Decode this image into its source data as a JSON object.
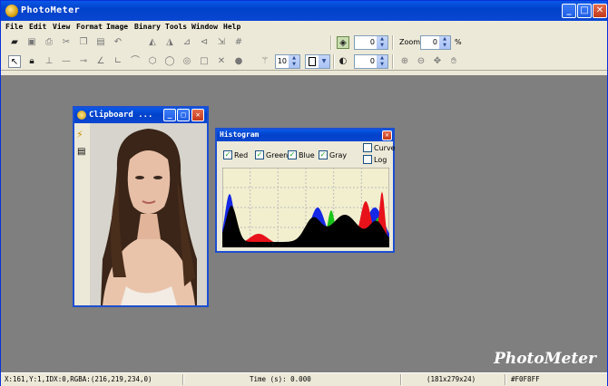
{
  "window": {
    "title": "PhotoMeter",
    "buttons": {
      "min": "_",
      "max": "□",
      "close": "✕"
    }
  },
  "menu": [
    "File",
    "Edit",
    "View",
    "Format",
    "Image",
    "Binary",
    "Tools",
    "Window",
    "Help"
  ],
  "toolbar1": {
    "icons": [
      "open-folder-icon",
      "save-icon",
      "print-icon",
      "cut-icon",
      "copy-icon",
      "paste-icon",
      "undo-icon",
      "mirror-icon",
      "flip-icon",
      "rotate-left-icon",
      "rotate-right-icon",
      "resize-icon",
      "grid-icon"
    ],
    "channel_value": "0",
    "zoom_label": "Zoom:",
    "zoom_value": "0",
    "zoom_unit": "%"
  },
  "toolbar2": {
    "icons": [
      "pointer-icon",
      "lock-icon",
      "tool-t-icon",
      "tool-line-icon",
      "tool-dash-icon",
      "tool-angle-icon",
      "tool-corner-icon",
      "tool-polyline-icon",
      "tool-polygon-icon",
      "tool-circle-icon",
      "tool-target-icon",
      "tool-rect-icon",
      "tool-x-icon",
      "tool-dot-icon",
      "tool-wand-icon"
    ],
    "size_value": "10",
    "contrast_value": "0",
    "view_icons": [
      "zoom-in-icon",
      "zoom-out-icon",
      "move-icon",
      "hand-icon"
    ]
  },
  "clipboard": {
    "title": "Clipboard ...",
    "side_icons": [
      "lightning-icon",
      "list-icon"
    ]
  },
  "histogram": {
    "title": "Histogram",
    "channels": [
      {
        "label": "Red",
        "checked": true
      },
      {
        "label": "Green",
        "checked": true
      },
      {
        "label": "Blue",
        "checked": true
      },
      {
        "label": "Gray",
        "checked": true
      }
    ],
    "options": [
      {
        "label": "Curve",
        "checked": false
      },
      {
        "label": "Log",
        "checked": false
      }
    ],
    "colors": {
      "red": "#e8121a",
      "green": "#18c418",
      "blue": "#1428e6",
      "gray": "#000000",
      "background": "#f2efcf"
    }
  },
  "brand": "PhotoMeter",
  "status": {
    "coords": "X:161,Y:1,IDX:0,RGBA:(216,219,234,0)",
    "time": "Time (s): 0.000",
    "dims": "(181x279x24)",
    "hex": "#F0F8FF"
  }
}
